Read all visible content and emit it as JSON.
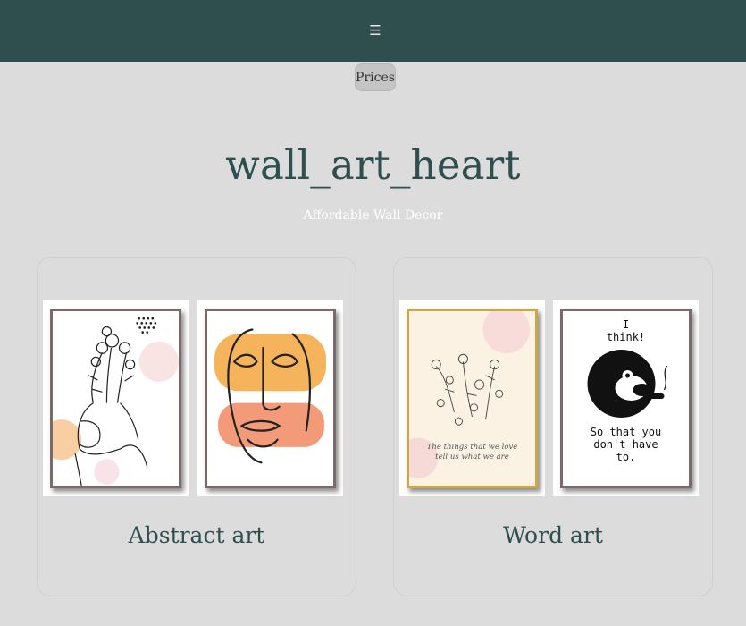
{
  "nav": {
    "menu_icon": "☰",
    "menu_icon_name": "hamburger-menu-icon"
  },
  "prices_button": {
    "label": "Prices"
  },
  "hero": {
    "title": "wall_art_heart",
    "subtitle": "Affordable Wall Decor"
  },
  "categories": [
    {
      "title": "Abstract art",
      "images": [
        "line-art-woman-with-flowers",
        "abstract-face-line-art"
      ]
    },
    {
      "title": "Word art",
      "images": [
        "floral-quote-print",
        "monkey-cigar-quote-print"
      ],
      "quote_1": "The things that we love tell us what we are",
      "quote_2_top": [
        "I",
        "think!"
      ],
      "quote_2_bottom": [
        "So that you",
        "don't have",
        "to."
      ]
    }
  ],
  "colors": {
    "header": "#2f4f4f",
    "background": "#dcdcdc",
    "title": "#2f4f4f"
  }
}
